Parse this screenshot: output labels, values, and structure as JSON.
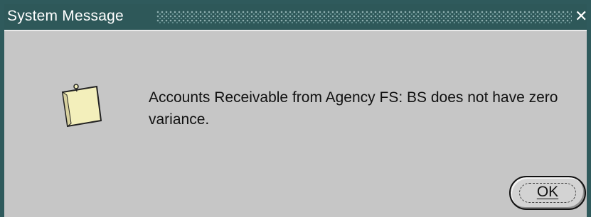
{
  "window": {
    "title": "System Message",
    "close_glyph": "✕"
  },
  "dialog": {
    "icon": "note-icon",
    "message": "Accounts Receivable from Agency FS: BS does not have zero variance.",
    "ok_label": "OK"
  },
  "colors": {
    "titlebar": "#2e5859",
    "window_bg": "#c6c6c6",
    "note": "#f3efbb"
  }
}
